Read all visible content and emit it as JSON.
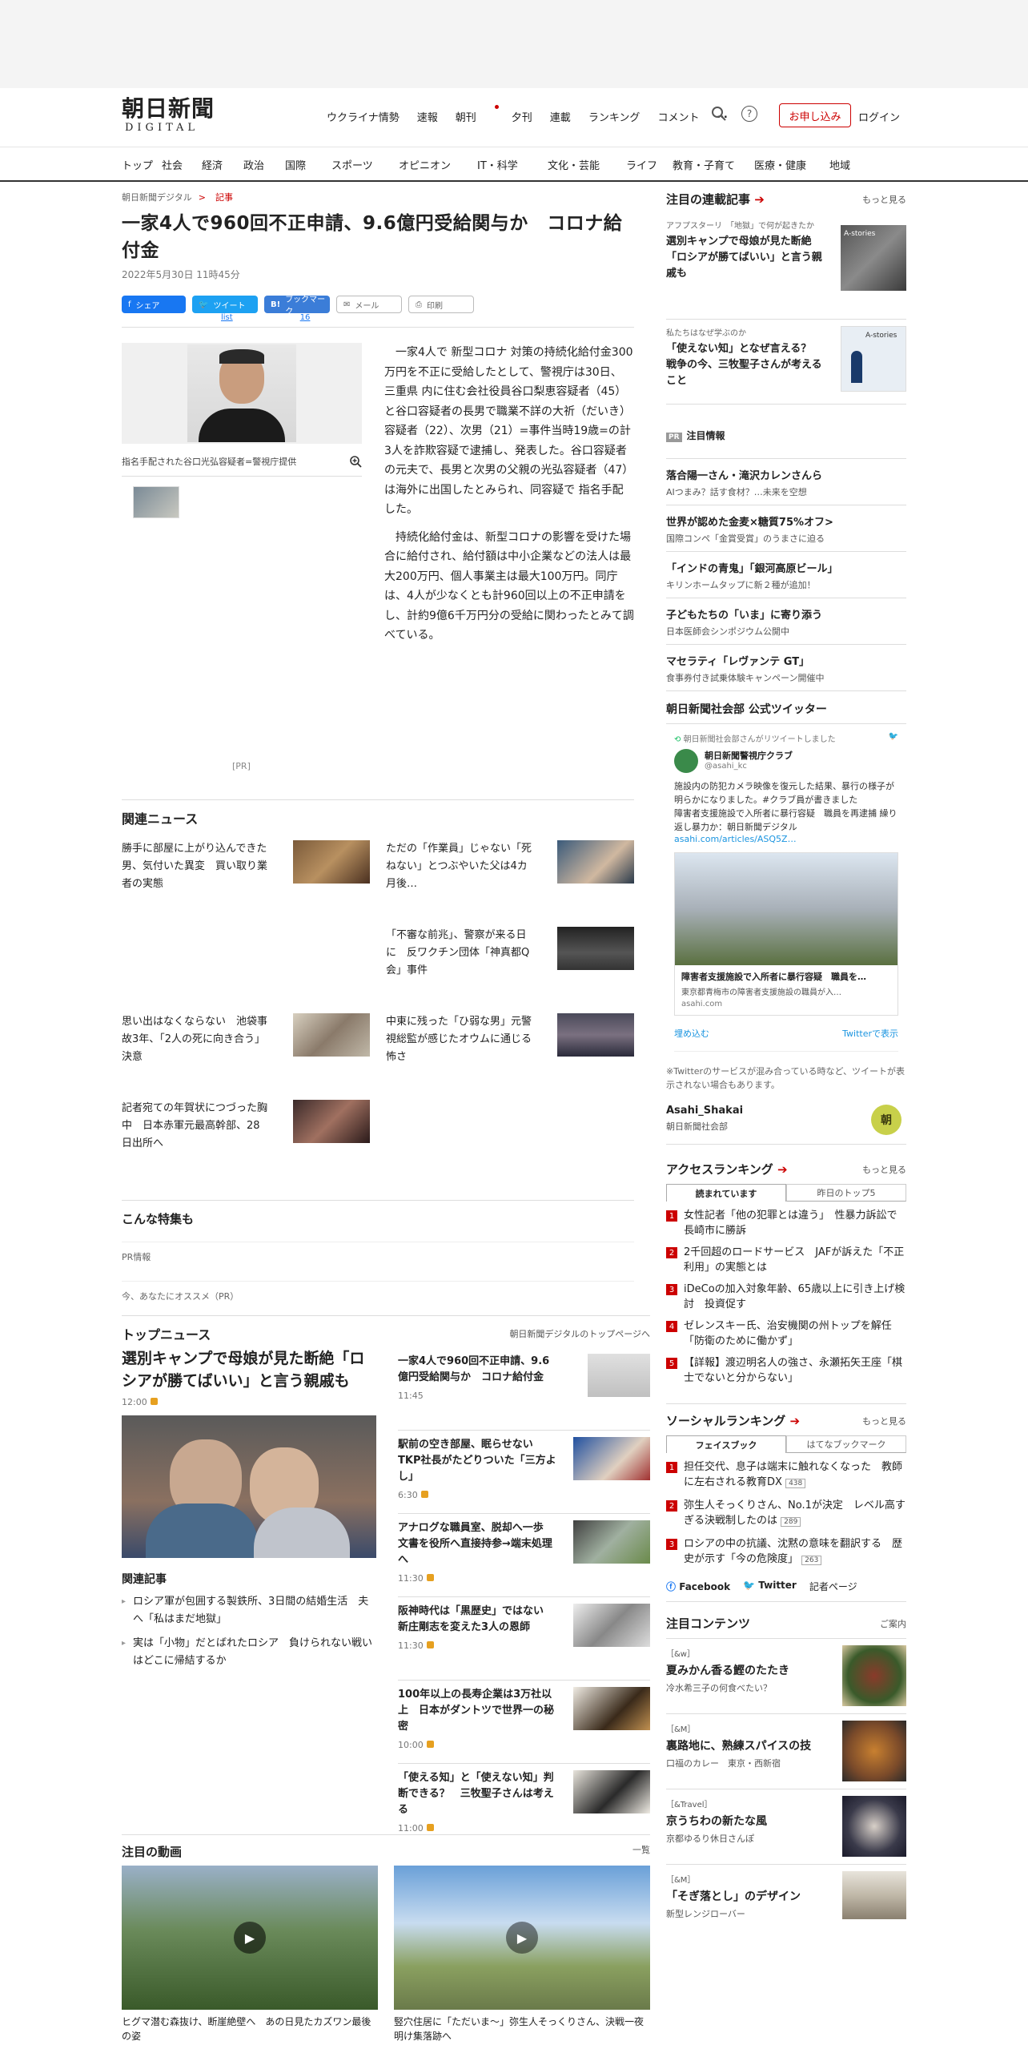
{
  "header": {
    "logo_main": "朝日新聞",
    "logo_sub": "DIGITAL",
    "nav": [
      "ウクライナ情勢",
      "速報",
      "朝刊",
      "夕刊",
      "連載",
      "ランキング",
      "コメント",
      "…"
    ],
    "subscribe": "お申し込み",
    "login": "ログイン",
    "help_icon": "?"
  },
  "categories": [
    "トップ",
    "社会",
    "経済",
    "政治",
    "国際",
    "スポーツ",
    "オピニオン",
    "IT・科学",
    "文化・芸能",
    "ライフ",
    "教育・子育て",
    "医療・健康",
    "地域"
  ],
  "article": {
    "breadcrumb": [
      "朝日新聞デジタル",
      "記事"
    ],
    "breadcrumb_sep": ">",
    "title": "一家4人で960回不正申請、9.6億円受給関与か　コロナ給付金",
    "date": "2022年5月30日 11時45分",
    "share": [
      "シェア",
      "ツイート",
      "ブックマーク",
      "メール",
      "印刷"
    ],
    "share_counts": [
      "list",
      "16"
    ],
    "photo_caption": "指名手配された谷口光弘容疑者=警視庁提供",
    "paragraphs": [
      "一家4人で 新型コロナ 対策の持続化給付金300万円を不正に受給したとして、警視庁は30日、 三重県 内に住む会社役員谷口梨恵容疑者（45）と谷口容疑者の長男で職業不詳の大祈（だいき）容疑者（22）、次男（21）=事件当時19歳=の計3人を詐欺容疑で逮捕し、発表した。谷口容疑者の元夫で、長男と次男の父親の光弘容疑者（47）は海外に出国したとみられ、同容疑で 指名手配 した。",
      "持続化給付金は、新型コロナの影響を受けた場合に給付され、給付額は中小企業などの法人は最大200万円、個人事業主は最大100万円。同庁は、4人が少なくとも計960回以上の不正申請をし、計約9億6千万円分の受給に関わったとみて調べている。"
    ],
    "pr": "[PR]"
  },
  "related": {
    "heading": "関連ニュース",
    "items": [
      "勝手に部屋に上がり込んできた男、気付いた異変　買い取り業者の実態",
      "ただの「作業員」じゃない「死ねない」とつぶやいた父は4カ月後…",
      "「不審な前兆」、警察が来る日に　反ワクチン団体「神真都Q会」事件",
      "思い出はなくならない　池袋事故3年、「2人の死に向き合う」決意",
      "中東に残った「ひ弱な男」元警視総監が感じたオウムに通じる怖さ",
      "記者宛ての年賀状につづった胸中　日本赤軍元最高幹部、28日出所へ"
    ]
  },
  "features": {
    "heading": "こんな特集も",
    "lines": [
      "PR情報",
      "今、あなたにオススメ（PR）"
    ]
  },
  "topnews": {
    "heading": "トップニュース",
    "more": "朝日新聞デジタルのトップページへ",
    "lead_title": "選別キャンプで母娘が見た断絶「ロシアが勝てばいい」と言う親戚も",
    "lead_time": "12:00",
    "related_heading": "関連記事",
    "related_items": [
      "ロシア軍が包囲する製鉄所、3日間の結婚生活　夫へ「私はまだ地獄」",
      "実は「小物」だとばれたロシア　負けられない戦いはどこに帰結するか"
    ],
    "items": [
      {
        "title": "一家4人で960回不正申請、9.6億円受給関与か　コロナ給付金",
        "time": "11:45"
      },
      {
        "title": "駅前の空き部屋、眠らせない　TKP社長がたどりついた「三方よし」",
        "time": "6:30"
      },
      {
        "title": "アナログな職員室、脱却へ一歩　文書を役所へ直接持参→端末処理へ",
        "time": "11:30"
      },
      {
        "title": "阪神時代は「黒歴史」ではない　新庄剛志を変えた3人の恩師",
        "time": "11:30"
      },
      {
        "title": "100年以上の長寿企業は3万社以上　日本がダントツで世界一の秘密",
        "time": "10:00"
      },
      {
        "title": "「使える知」と「使えない知」判断できる？　三牧聖子さんは考える",
        "time": "11:00"
      }
    ]
  },
  "videos": {
    "heading": "注目の動画",
    "more": "一覧",
    "items": [
      "ヒグマ潜む森抜け、断崖絶壁へ　あの日見たカズワン最後の姿",
      "竪穴住居に「ただいま～」弥生人そっくりさん、決戦一夜明け集落跡へ"
    ]
  },
  "sidebar": {
    "serial": {
      "heading": "注目の連載記事",
      "more": "もっと見る",
      "items": [
        {
          "label": "アフプスターリ　「地獄」で何が起きたか",
          "title": "選別キャンプで母娘が見た断絶　「ロシアが勝てばいい」と言う親戚も",
          "badge": "A-stories"
        },
        {
          "label": "私たちはなぜ学ぶのか",
          "title": "「使えない知」となぜ言える？　戦争の今、三牧聖子さんが考えること",
          "badge": "A-stories"
        }
      ]
    },
    "pr_info": {
      "heading": "注目情報",
      "tag": "PR",
      "items": [
        {
          "t": "落合陽一さん・滝沢カレンさんら",
          "s": "AIつまみ？話す食材？…未来を空想"
        },
        {
          "t": "世界が認めた金麦×糖質75%オフ>",
          "s": "国際コンペ「金賞受賞」のうまさに迫る"
        },
        {
          "t": "「インドの青鬼」「銀河高原ビール」",
          "s": "キリンホームタップに新２種が追加！"
        },
        {
          "t": "子どもたちの「いま」に寄り添う",
          "s": "日本医師会シンポジウム公開中"
        },
        {
          "t": "マセラティ「レヴァンテ GT」",
          "s": "食事券付き試乗体験キャンペーン開催中"
        }
      ]
    },
    "twitter": {
      "heading": "朝日新聞社会部 公式ツイッター",
      "retweet": "朝日新聞社会部さんがリツイートしました",
      "account": "朝日新聞警視庁クラブ",
      "handle": "@asahi_kc",
      "text": "施設内の防犯カメラ映像を復元した結果、暴行の様子が明らかになりました。#クラブ員が書きました",
      "text2": "障害者支援施設で入所者に暴行容疑　職員を再逮捕 繰り返し暴力か：朝日新聞デジタル",
      "link": "asahi.com/articles/ASQ5Z…",
      "card_title": "障害者支援施設で入所者に暴行容疑　職員を…",
      "card_desc": "東京都青梅市の障害者支援施設の職員が入…",
      "card_domain": "asahi.com",
      "embed": "埋め込む",
      "view": "Twitterで表示",
      "note": "※Twitterのサービスが混み合っている時など、ツイートが表示されない場合もあります。",
      "profile_name": "Asahi_Shakai",
      "profile_sub": "朝日新聞社会部",
      "profile_badge": "朝"
    },
    "access": {
      "heading": "アクセスランキング",
      "more": "もっと見る",
      "tabs": [
        "読まれています",
        "昨日のトップ5"
      ],
      "items": [
        "女性記者「他の犯罪とは違う」　性暴力訴訟で長崎市に勝訴",
        "2千回超のロードサービス　JAFが訴えた「不正利用」の実態とは",
        "iDeCoの加入対象年齢、65歳以上に引き上げ検討　投資促す",
        "ゼレンスキー氏、治安機関の州トップを解任「防衛のために働かず」",
        "【詳報】渡辺明名人の強さ、永瀬拓矢王座「棋士でないと分からない」"
      ]
    },
    "social": {
      "heading": "ソーシャルランキング",
      "more": "もっと見る",
      "tabs": [
        "フェイスブック",
        "はてなブックマーク"
      ],
      "items": [
        {
          "t": "担任交代、息子は端末に触れなくなった　教師に左右される教育DX",
          "n": "438"
        },
        {
          "t": "弥生人そっくりさん、No.1が決定　レベル高すぎる決戦制したのは",
          "n": "289"
        },
        {
          "t": "ロシアの中の抗議、沈黙の意味を翻訳する　歴史が示す「今の危険度」",
          "n": "263"
        }
      ],
      "links": [
        "Facebook",
        "Twitter",
        "記者ページ"
      ]
    },
    "contents": {
      "heading": "注目コンテンツ",
      "more": "ご案内",
      "items": [
        {
          "tag": "［&w］",
          "t": "夏みかん香る鰹のたたき",
          "s": "冷水希三子の何食べたい？"
        },
        {
          "tag": "［&M］",
          "t": "裏路地に、熟練スパイスの技",
          "s": "口福のカレー　東京・西新宿"
        },
        {
          "tag": "［&Travel］",
          "t": "京うちわの新たな風",
          "s": "京都ゆるり休日さんぽ"
        },
        {
          "tag": "［&M］",
          "t": "「そぎ落とし」のデザイン",
          "s": "新型レンジローバー"
        }
      ]
    }
  }
}
